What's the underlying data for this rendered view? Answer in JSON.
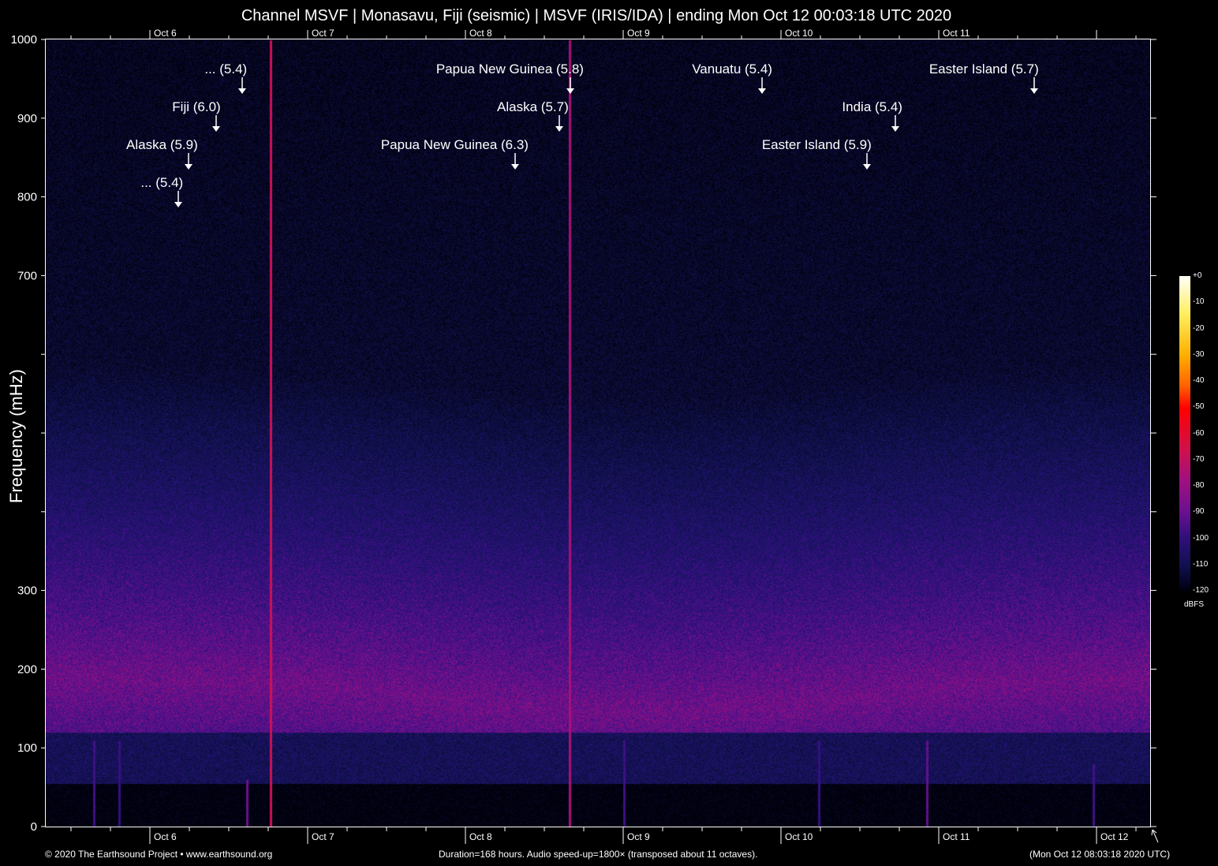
{
  "title": "Channel MSVF | Monasavu, Fiji (seismic) | MSVF (IRIS/IDA) | ending Mon Oct 12 00:03:18 UTC 2020",
  "footer": {
    "copyright": "© 2020 The Earthsound Project • www.earthsound.org",
    "info": "Duration=168 hours. Audio speed-up=1800× (transposed about 11 octaves).",
    "local_time": "(Mon Oct 12 08:03:18 2020 UTC)"
  },
  "chart_data": {
    "type": "heatmap",
    "title": "Channel MSVF | Monasavu, Fiji (seismic) | MSVF (IRIS/IDA) | ending Mon Oct 12 00:03:18 UTC 2020",
    "xlabel": "",
    "ylabel": "Frequency (mHz)",
    "ylim": [
      0,
      1000
    ],
    "y_ticks": [
      {
        "v": 0,
        "label": "0"
      },
      {
        "v": 100,
        "label": "100"
      },
      {
        "v": 200,
        "label": "200"
      },
      {
        "v": 300,
        "label": "300"
      },
      {
        "v": 400,
        "label": ""
      },
      {
        "v": 500,
        "label": ""
      },
      {
        "v": 600,
        "label": ""
      },
      {
        "v": 700,
        "label": "700"
      },
      {
        "v": 800,
        "label": "800"
      },
      {
        "v": 900,
        "label": "900"
      },
      {
        "v": 1000,
        "label": "1000"
      }
    ],
    "x_range_days": [
      5.34,
      12.34
    ],
    "x_ticks": [
      {
        "day": 6,
        "label": "Oct 6"
      },
      {
        "day": 7,
        "label": "Oct 7"
      },
      {
        "day": 8,
        "label": "Oct 8"
      },
      {
        "day": 9,
        "label": "Oct 9"
      },
      {
        "day": 10,
        "label": "Oct 10"
      },
      {
        "day": 11,
        "label": "Oct 11"
      },
      {
        "day": 12,
        "label": "Oct 12"
      }
    ],
    "colorbar": {
      "label": "dBFS",
      "range": [
        -120,
        0
      ],
      "ticks": [
        "+0",
        "-10",
        "-20",
        "-30",
        "-40",
        "-50",
        "-60",
        "-70",
        "-80",
        "-90",
        "-100",
        "-110",
        "-120"
      ]
    },
    "events": [
      {
        "label": "... (5.4)",
        "day": 6.585
      },
      {
        "label": "Papua New Guinea (5.8)",
        "day": 8.665
      },
      {
        "label": "Vanuatu (5.4)",
        "day": 9.88
      },
      {
        "label": "Easter Island (5.7)",
        "day": 11.605
      },
      {
        "label": "Fiji (6.0)",
        "day": 6.42
      },
      {
        "label": "Alaska (5.7)",
        "day": 8.595
      },
      {
        "label": "India (5.4)",
        "day": 10.725
      },
      {
        "label": "Alaska (5.9)",
        "day": 6.245
      },
      {
        "label": "Papua New Guinea (6.3)",
        "day": 8.315
      },
      {
        "label": "Easter Island (5.9)",
        "day": 10.545
      },
      {
        "label": "... (5.4)",
        "day": 6.18
      }
    ]
  }
}
